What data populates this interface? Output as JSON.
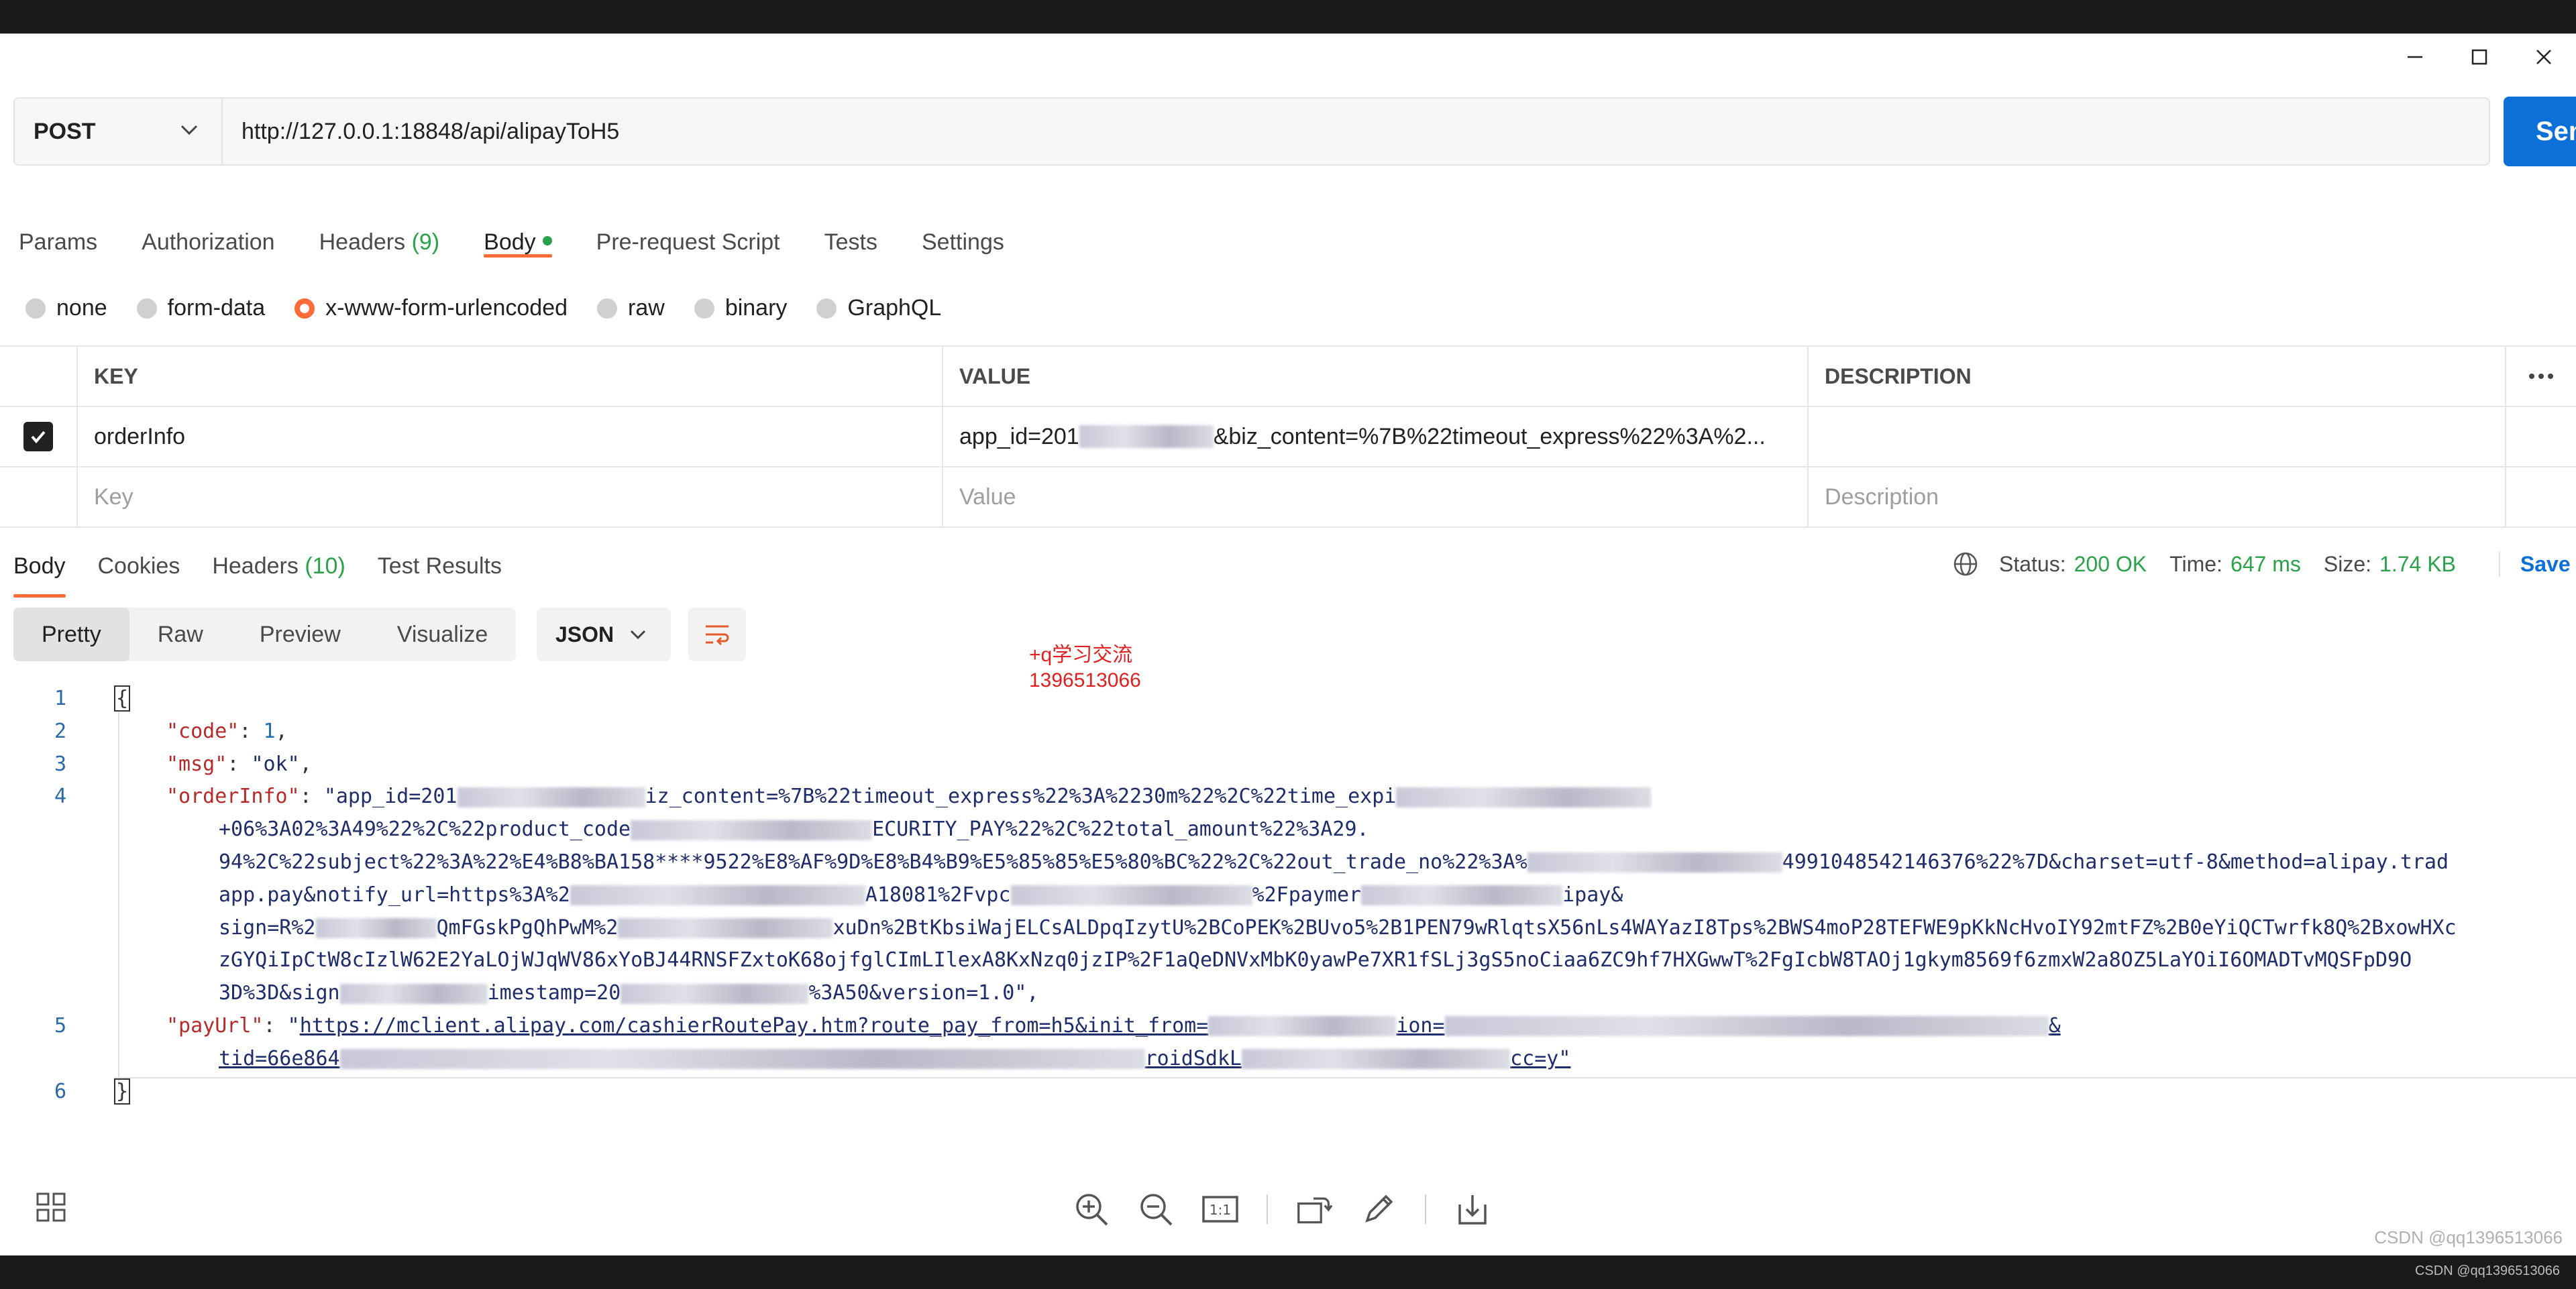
{
  "window": {
    "controls": [
      "minimize-icon",
      "maximize-icon",
      "close-icon"
    ]
  },
  "request": {
    "method": "POST",
    "url": "http://127.0.0.1:18848/api/alipayToH5",
    "send_label": "Sen"
  },
  "request_tabs": {
    "params": "Params",
    "authorization": "Authorization",
    "headers": "Headers",
    "headers_count": "(9)",
    "body": "Body",
    "pre_request": "Pre-request Script",
    "tests": "Tests",
    "settings": "Settings"
  },
  "body_types": {
    "none": "none",
    "form_data": "form-data",
    "urlencoded": "x-www-form-urlencoded",
    "raw": "raw",
    "binary": "binary",
    "graphql": "GraphQL",
    "selected": "x-www-form-urlencoded"
  },
  "params_table": {
    "headers": {
      "key": "KEY",
      "value": "VALUE",
      "description": "DESCRIPTION"
    },
    "rows": [
      {
        "key": "orderInfo",
        "value_prefix": "app_id=201",
        "value_suffix": "&biz_content=%7B%22timeout_express%22%3A%2...",
        "checked": true
      }
    ],
    "placeholders": {
      "key": "Key",
      "value": "Value",
      "description": "Description"
    }
  },
  "response_tabs": {
    "body": "Body",
    "cookies": "Cookies",
    "headers": "Headers",
    "headers_count": "(10)",
    "test_results": "Test Results"
  },
  "response_meta": {
    "status_label": "Status:",
    "status_value": "200 OK",
    "time_label": "Time:",
    "time_value": "647 ms",
    "size_label": "Size:",
    "size_value": "1.74 KB",
    "save_label": "Save Res"
  },
  "response_view": {
    "pretty": "Pretty",
    "raw": "Raw",
    "preview": "Preview",
    "visualize": "Visualize",
    "format": "JSON"
  },
  "note": {
    "line1": "+q学习交流",
    "line2": "1396513066"
  },
  "code": {
    "line_numbers": [
      "1",
      "2",
      "3",
      "4",
      "5",
      "6"
    ],
    "l1": "{",
    "l2_key": "\"code\"",
    "l2_val": "1",
    "l3_key": "\"msg\"",
    "l3_val": "\"ok\"",
    "l4_key": "\"orderInfo\"",
    "l4a_pre": "\"app_id=201",
    "l4a_post": "iz_content=%7B%22timeout_express%22%3A%2230m%22%2C%22time_expi",
    "l4b_pre": "+06%3A02%3A49%22%2C%22product_code",
    "l4b_post": "ECURITY_PAY%22%2C%22total_amount%22%3A29.",
    "l4c_pre": "94%2C%22subject%22%3A%22%E4%B8%BA158****9522%E8%AF%9D%E8%B4%B9%E5%85%85%E5%80%BC%22%2C%22out_trade_no%22%3A%",
    "l4c_post": "4991048542146376%22%7D&charset=utf-8&method=alipay.trad",
    "l4d_pre": "app.pay&notify_url=https%3A%2",
    "l4d_mid": "A18081%2Fvpc",
    "l4d_mid2": "%2Fpaymer",
    "l4d_post": "ipay&",
    "l4e_pre": "sign=R%2",
    "l4e_mid": "QmFGskPgQhPwM%2",
    "l4e_post": "xuDn%2BtKbsiWajELCsALDpqIzytU%2BCoPEK%2BUvo5%2B1PEN79wRlqtsX56nLs4WAYazI8Tps%2BWS4moP28TEFWE9pKkNcHvoIY92mtFZ%2B0eYiQCTwrfk8Q%2BxowHXc",
    "l4f": "zGYQiIpCtW8cIzlW62E2YaLOjWJqWV86xYoBJ44RNSFZxtoK68ojfglCImLIlexA8KxNzq0jzIP%2F1aQeDNVxMbK0yawPe7XR1fSLj3gS5noCiaa6ZC9hf7HXGwwT%2FgIcbW8TAOj1gkym8569f6zmxW2a8OZ5LaYOiI6OMADTvMQSFpD9O",
    "l4g_pre": "3D%3D&sign",
    "l4g_mid": "imestamp=20",
    "l4g_post": "%3A50&version=1.0\",",
    "l5_key": "\"payUrl\"",
    "l5a_pre": "\"",
    "l5a_link": "https://mclient.alipay.com/cashierRoutePay.htm?route_pay_from=h5&init_from=",
    "l5a_mid": "ion=",
    "l5a_end": "&",
    "l5b_pre": "tid=66e864",
    "l5b_mid": "roidSdkL",
    "l5b_post": "cc=y\"",
    "l6": "}"
  },
  "watermark": "CSDN @qq1396513066",
  "watermark_small": "CSDN @qq1396513066"
}
